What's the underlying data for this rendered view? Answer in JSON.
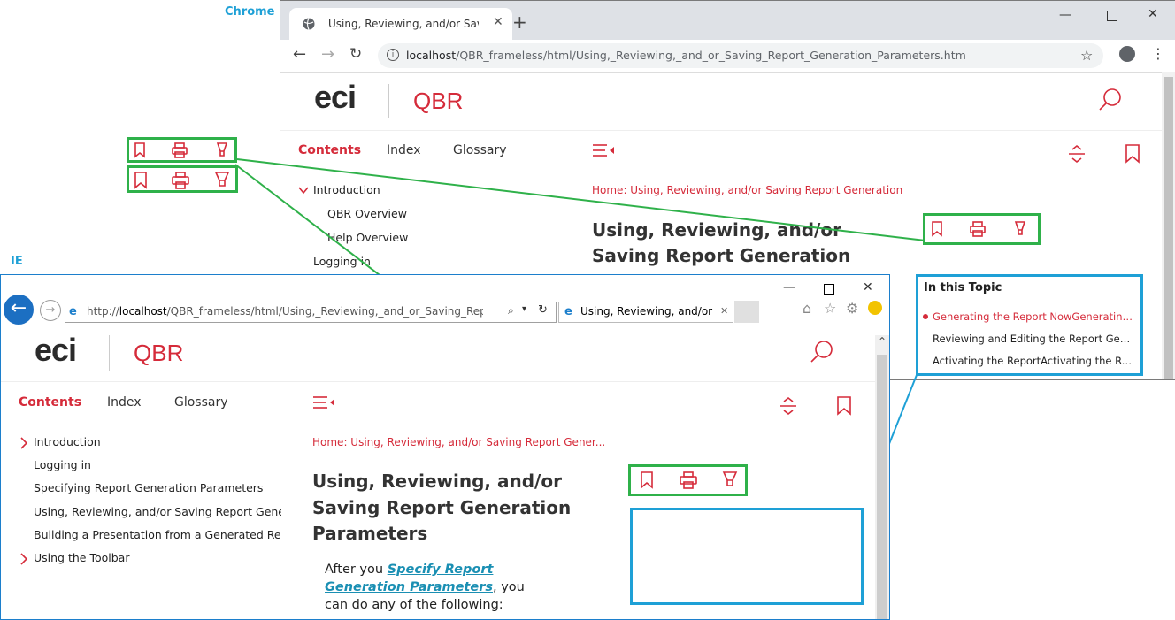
{
  "labels": {
    "chrome": "Chrome",
    "ie": "IE"
  },
  "chrome": {
    "tab_title": "Using, Reviewing, and/or Saving Report Generation Parameters",
    "url_host": "localhost",
    "url_path": "/QBR_frameless/html/Using,_Reviewing,_and_or_Saving_Report_Generation_Parameters.htm"
  },
  "site": {
    "logo": "eci",
    "product": "QBR",
    "tabs": [
      "Contents",
      "Index",
      "Glossary"
    ]
  },
  "chrome_toc": [
    {
      "label": "Introduction",
      "level": 0,
      "expanded": true
    },
    {
      "label": "QBR Overview",
      "level": 1
    },
    {
      "label": "Help Overview",
      "level": 1
    },
    {
      "label": "Logging in",
      "level": 0
    }
  ],
  "chrome_content": {
    "breadcrumb": "Home: Using, Reviewing, and/or Saving Report Generation",
    "title_line1": "Using, Reviewing, and/or",
    "title_line2": "Saving Report Generation"
  },
  "topic_box": {
    "title": "In this Topic",
    "items": [
      "Generating the Report NowGenerating t...",
      "Reviewing and Editing the Report Gener...",
      "Activating the ReportActivating the Rep..."
    ]
  },
  "ie": {
    "url_host": "localhost",
    "url_path": "/QBR_frameless/html/Using,_Reviewing,_and_or_Saving_Report_Generatio",
    "tab_title": "Using, Reviewing, and/or S..."
  },
  "ie_toc": [
    {
      "label": "Introduction",
      "arrow": true
    },
    {
      "label": "Logging in",
      "arrow": false
    },
    {
      "label": "Specifying Report Generation Parameters",
      "arrow": false
    },
    {
      "label": "Using, Reviewing, and/or Saving Report Generat",
      "arrow": false
    },
    {
      "label": "Building a Presentation from a Generated Repor",
      "arrow": false
    },
    {
      "label": "Using the Toolbar",
      "arrow": true
    }
  ],
  "ie_content": {
    "breadcrumb": "Home: Using, Reviewing, and/or Saving Report Gener...",
    "title_line1": "Using, Reviewing, and/or",
    "title_line2": "Saving Report Generation",
    "title_line3": "Parameters",
    "para_before": "After you ",
    "para_link": "Specify Report Generation Parameters",
    "para_after": ", you can do any of the following:"
  },
  "colors": {
    "brand_red": "#d52b3a",
    "callout_green": "#2fb14a",
    "callout_blue": "#1ea0d6"
  }
}
